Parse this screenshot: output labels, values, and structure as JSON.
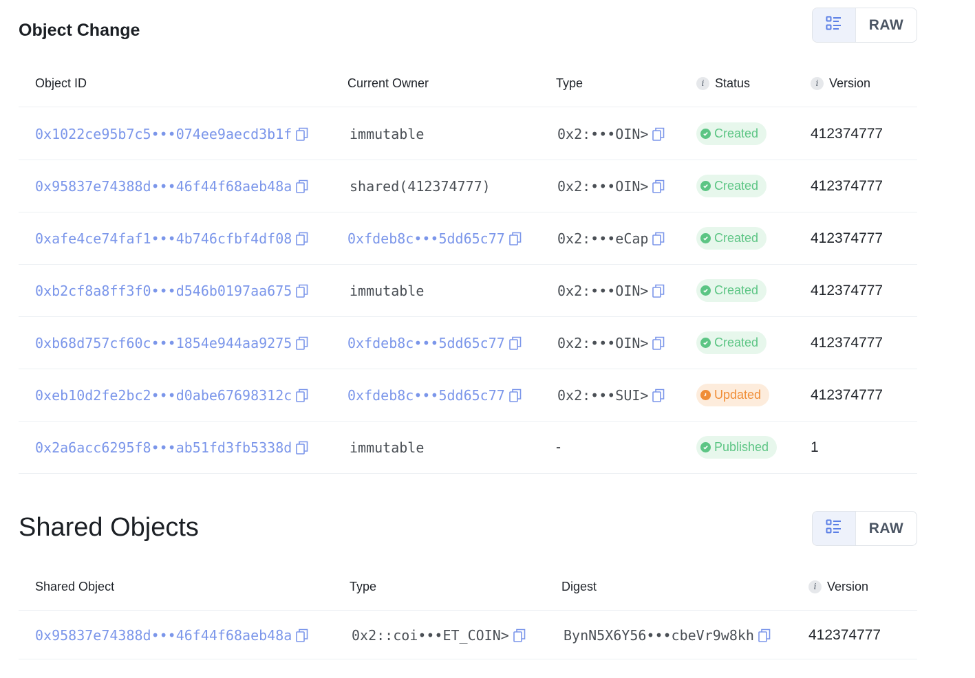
{
  "object_change": {
    "title": "Object Change",
    "toggle": {
      "list_icon": "list-view-icon",
      "raw_label": "RAW"
    },
    "columns": {
      "object_id": "Object ID",
      "current_owner": "Current Owner",
      "type": "Type",
      "status": "Status",
      "version": "Version"
    },
    "rows": [
      {
        "object_id": "0x1022ce95b7c5•••074ee9aecd3b1f",
        "owner": "immutable",
        "owner_is_link": false,
        "type": "0x2:•••OIN>",
        "status": "Created",
        "version": "412374777"
      },
      {
        "object_id": "0x95837e74388d•••46f44f68aeb48a",
        "owner": "shared(412374777)",
        "owner_is_link": false,
        "type": "0x2:•••OIN>",
        "status": "Created",
        "version": "412374777"
      },
      {
        "object_id": "0xafe4ce74faf1•••4b746cfbf4df08",
        "owner": "0xfdeb8c•••5dd65c77",
        "owner_is_link": true,
        "type": "0x2:•••eCap",
        "status": "Created",
        "version": "412374777"
      },
      {
        "object_id": "0xb2cf8a8ff3f0•••d546b0197aa675",
        "owner": "immutable",
        "owner_is_link": false,
        "type": "0x2:•••OIN>",
        "status": "Created",
        "version": "412374777"
      },
      {
        "object_id": "0xb68d757cf60c•••1854e944aa9275",
        "owner": "0xfdeb8c•••5dd65c77",
        "owner_is_link": true,
        "type": "0x2:•••OIN>",
        "status": "Created",
        "version": "412374777"
      },
      {
        "object_id": "0xeb10d2fe2bc2•••d0abe67698312c",
        "owner": "0xfdeb8c•••5dd65c77",
        "owner_is_link": true,
        "type": "0x2:•••SUI>",
        "status": "Updated",
        "version": "412374777"
      },
      {
        "object_id": "0x2a6acc6295f8•••ab51fd3fb5338d",
        "owner": "immutable",
        "owner_is_link": false,
        "type": "-",
        "status": "Published",
        "version": "1"
      }
    ]
  },
  "shared_objects": {
    "title": "Shared Objects",
    "toggle": {
      "list_icon": "list-view-icon",
      "raw_label": "RAW"
    },
    "columns": {
      "shared_object": "Shared Object",
      "type": "Type",
      "digest": "Digest",
      "version": "Version"
    },
    "rows": [
      {
        "shared_object": "0x95837e74388d•••46f44f68aeb48a",
        "type": "0x2::coi•••ET_COIN>",
        "digest": "BynN5X6Y56•••cbeVr9w8kh",
        "version": "412374777"
      }
    ]
  },
  "colors": {
    "link": "#7b96ea",
    "created_bg": "#e7f7ec",
    "created_fg": "#5cc584",
    "updated_bg": "#fdecdc",
    "updated_fg": "#f08d36",
    "toggle_active_bg": "#eef2fb"
  }
}
